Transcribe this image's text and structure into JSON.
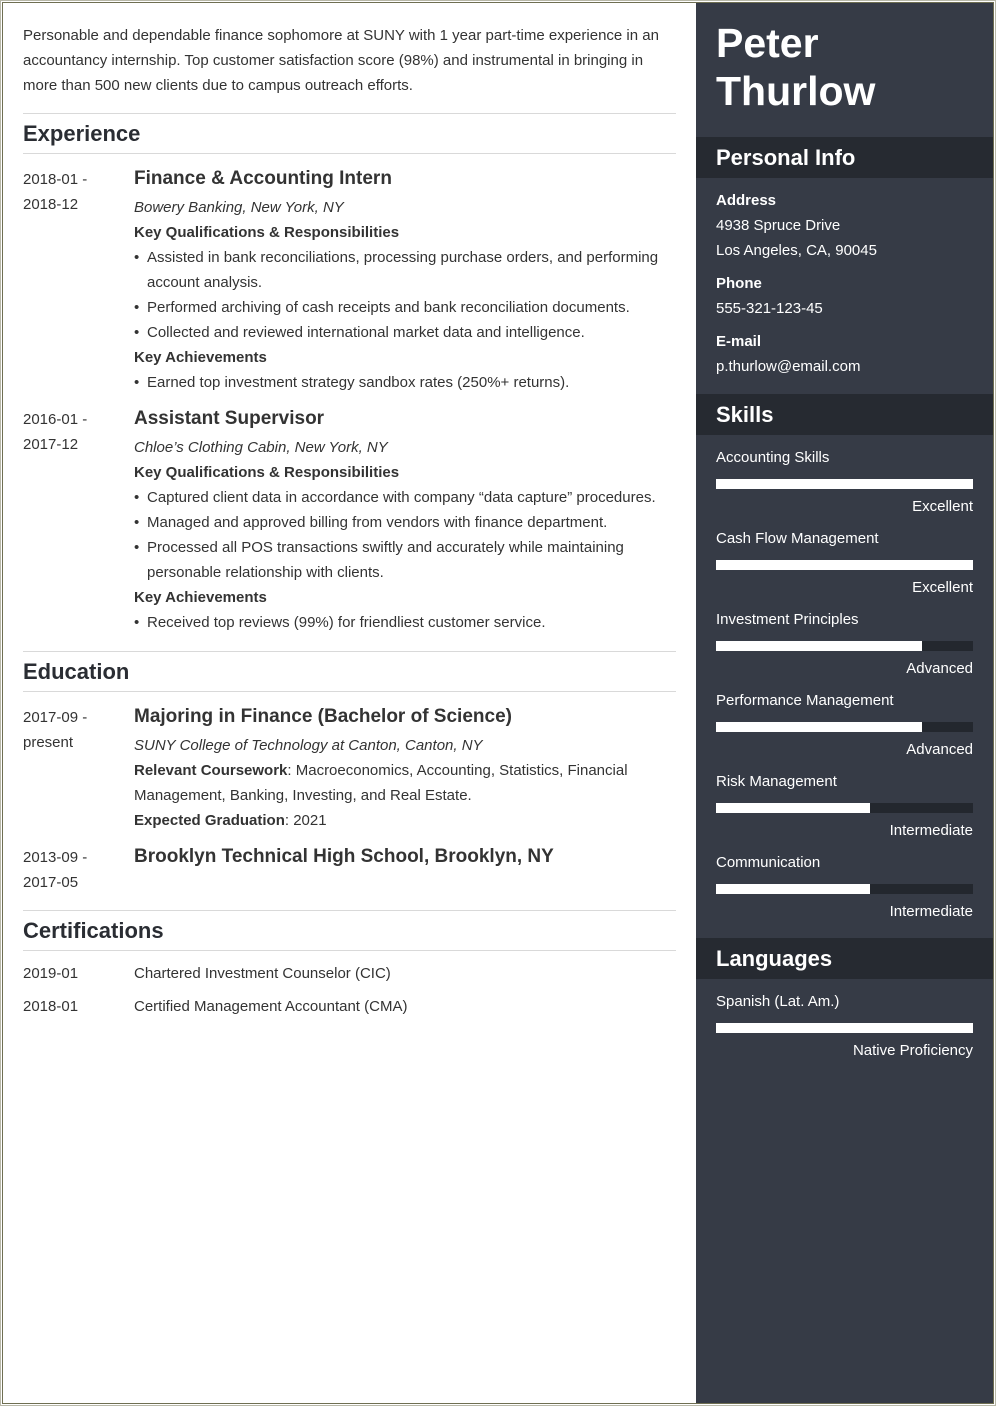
{
  "profile": {
    "first_name": "Peter",
    "last_name": "Thurlow",
    "summary": "Personable and dependable finance sophomore at SUNY with 1 year part-time experience in an accountancy internship. Top customer satisfaction score (98%) and instrumental in bringing in more than 500 new clients due to campus outreach efforts."
  },
  "experience": {
    "heading": "Experience",
    "jobs": [
      {
        "date_start": "2018-01 -",
        "date_end": "2018-12",
        "title": "Finance & Accounting Intern",
        "company": "Bowery Banking, New York, NY",
        "qual_heading": "Key Qualifications & Responsibilities",
        "qualifications": [
          "Assisted in bank reconciliations, processing purchase orders, and performing account analysis.",
          "Performed archiving of cash receipts and bank reconciliation documents.",
          "Collected and reviewed international market data and intelligence."
        ],
        "ach_heading": "Key Achievements",
        "achievements": [
          "Earned top investment strategy sandbox rates (250%+ returns)."
        ]
      },
      {
        "date_start": "2016-01 -",
        "date_end": "2017-12",
        "title": "Assistant Supervisor",
        "company": "Chloe’s Clothing Cabin, New York, NY",
        "qual_heading": "Key Qualifications & Responsibilities",
        "qualifications": [
          "Captured client data in accordance with company “data capture” procedures.",
          "Managed and approved billing from vendors with finance department.",
          "Processed all POS transactions swiftly and accurately while maintaining personable relationship with clients."
        ],
        "ach_heading": "Key Achievements",
        "achievements": [
          "Received top reviews (99%) for friendliest customer service."
        ]
      }
    ]
  },
  "education": {
    "heading": "Education",
    "items": [
      {
        "date_start": "2017-09 -",
        "date_end": "present",
        "degree": "Majoring in Finance (Bachelor of Science)",
        "school": "SUNY College of Technology at Canton, Canton, NY",
        "coursework_label": "Relevant Coursework",
        "coursework": ": Macroeconomics, Accounting, Statistics, Financial Management, Banking, Investing, and Real Estate.",
        "graduation_label": "Expected Graduation",
        "graduation": ": 2021"
      },
      {
        "date_start": "2013-09 -",
        "date_end": "2017-05",
        "degree": "Brooklyn Technical High School, Brooklyn, NY"
      }
    ]
  },
  "certifications": {
    "heading": "Certifications",
    "items": [
      {
        "date": "2019-01",
        "name": "Chartered Investment Counselor (CIC)"
      },
      {
        "date": "2018-01",
        "name": "Certified Management Accountant (CMA)"
      }
    ]
  },
  "personal_info": {
    "heading": "Personal Info",
    "address_label": "Address",
    "address_line1": "4938 Spruce Drive",
    "address_line2": "Los Angeles, CA, 90045",
    "phone_label": "Phone",
    "phone": "555-321-123-45",
    "email_label": "E-mail",
    "email": "p.thurlow@email.com"
  },
  "skills": {
    "heading": "Skills",
    "items": [
      {
        "name": "Accounting Skills",
        "level": "Excellent",
        "fill": 1.0
      },
      {
        "name": "Cash Flow Management",
        "level": "Excellent",
        "fill": 1.0
      },
      {
        "name": "Investment Principles",
        "level": "Advanced",
        "fill": 0.8
      },
      {
        "name": "Performance Management",
        "level": "Advanced",
        "fill": 0.8
      },
      {
        "name": "Risk Management",
        "level": "Intermediate",
        "fill": 0.6
      },
      {
        "name": "Communication",
        "level": "Intermediate",
        "fill": 0.6
      }
    ]
  },
  "languages": {
    "heading": "Languages",
    "items": [
      {
        "name": "Spanish (Lat. Am.)",
        "level": "Native Proficiency",
        "fill": 1.0
      }
    ]
  },
  "colors": {
    "sidebar_bg": "#363b46",
    "sidebar_band": "#262a31",
    "bar_fill": "#ffffff",
    "bar_track": "#23272e"
  }
}
